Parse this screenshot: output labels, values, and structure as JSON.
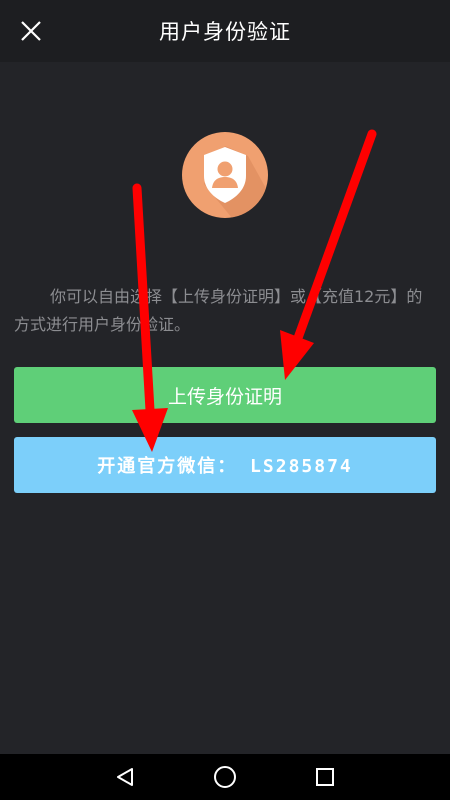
{
  "header": {
    "title": "用户身份验证",
    "close_icon": "close-icon"
  },
  "main": {
    "avatar_icon": "user-shield-icon",
    "description": "你可以自由选择【上传身份证明】或【充值12元】的方式进行用户身份验证。",
    "upload_button_label": "上传身份证明",
    "wechat_button_label": "开通官方微信： LS285874"
  },
  "annotations": {
    "arrow_color": "#ff0000",
    "arrow_count": 2
  },
  "navbar": {
    "back_icon": "back-triangle-icon",
    "home_icon": "home-circle-icon",
    "recents_icon": "recents-square-icon"
  },
  "colors": {
    "upload_button": "#5fcf78",
    "wechat_button": "#7ccffa",
    "avatar_circle": "#f0a070"
  }
}
